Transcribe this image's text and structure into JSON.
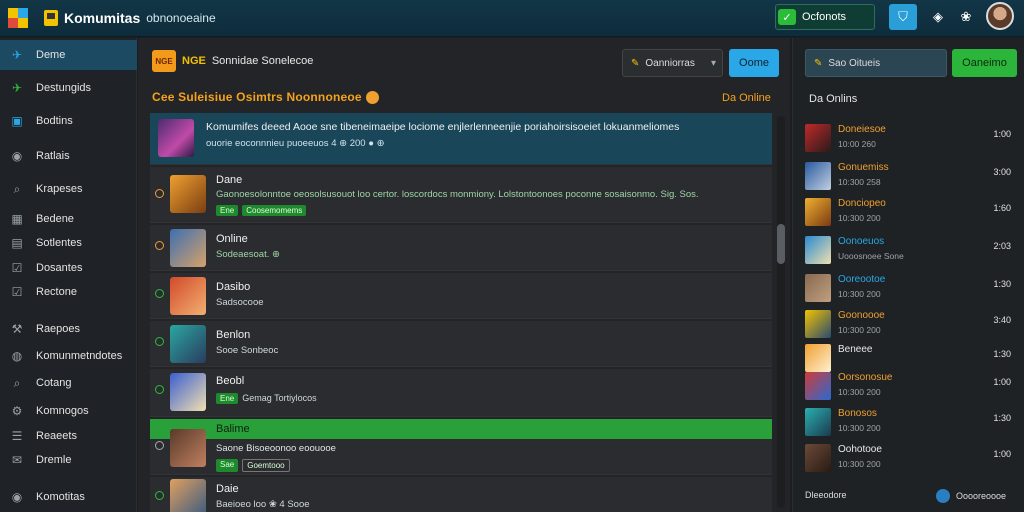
{
  "header": {
    "title": "Komumitas",
    "subtitle": "obnonoeaine",
    "status_label": "Ocfonots",
    "status_check": "✓",
    "icons": [
      "shield-icon",
      "gamepad-icon",
      "paw-icon"
    ]
  },
  "sidebar": {
    "items": [
      {
        "label": "Deme",
        "icon": "plane-icon",
        "glyph": "✈",
        "active": true
      },
      {
        "label": "Destungids",
        "icon": "plane-icon",
        "glyph": "✈"
      },
      {
        "label": "Bodtins",
        "icon": "square-icon",
        "glyph": "▣"
      },
      {
        "label": "Ratlais",
        "icon": "circle-icon",
        "glyph": "◉"
      },
      {
        "label": "Krapeses",
        "icon": "search-icon",
        "glyph": "⌕"
      },
      {
        "label": "Bedene",
        "icon": "grid-icon",
        "glyph": "▦"
      },
      {
        "label": "Sotlentes",
        "icon": "grid-icon",
        "glyph": "▤"
      },
      {
        "label": "Dosantes",
        "icon": "checkbox-icon",
        "glyph": "☑"
      },
      {
        "label": "Rectone",
        "icon": "checkbox-icon",
        "glyph": "☑"
      },
      {
        "label": "Raepoes",
        "icon": "wrench-icon",
        "glyph": "⚒"
      },
      {
        "label": "Komunmetndotes",
        "icon": "globe-icon",
        "glyph": "◍"
      },
      {
        "label": "Cotang",
        "icon": "search-icon",
        "glyph": "⌕"
      },
      {
        "label": "Komnogos",
        "icon": "tools-icon",
        "glyph": "⚙"
      },
      {
        "label": "Reaeets",
        "icon": "list-icon",
        "glyph": "☰"
      },
      {
        "label": "Dremle",
        "icon": "mail-icon",
        "glyph": "✉"
      },
      {
        "label": "Komotitas",
        "icon": "circle-icon",
        "glyph": "◉"
      }
    ]
  },
  "main": {
    "badge": "NGE",
    "header_title": "NGE",
    "header_text": "Sonnidae Sonelecoe",
    "select_label": "Oanniorras",
    "join_button": "Oome",
    "section_title": "Cee Suleisiue Osimtrs Noonnoneoe",
    "section_right": "Da Online",
    "rows": [
      {
        "name": "Komumifes deeed Aooe sne tibeneimaeipe lociome enjlerlenneenjie poriahoirsisoeiet lokuanmeliomes",
        "line2": "ouorie eoconnnieu puoeeuos 4 ⊕ 200 ● ⊕",
        "highlight": true
      },
      {
        "name": "Dane",
        "line2": "Gaonoesolonntoe oeosolsusouot loo certor. loscordocs monmiony. Lolstontoonoes poconne sosaisonmo. Sig. Sos.",
        "tags": [
          "Ene",
          "Coosemomems"
        ]
      },
      {
        "name": "Online",
        "line2": "Sodeaesoat. ⊕"
      },
      {
        "name": "Dasibo",
        "line2": "Sadsocooe"
      },
      {
        "name": "Benlon",
        "line2": "Sooe Sonbeoc"
      },
      {
        "name": "Beobl",
        "line2": "Gemag Tortiylocos",
        "tags": [
          "Ene"
        ]
      },
      {
        "name": "Balime",
        "line2": "Saone Bisoeoonoo eoouooe",
        "tags": [
          "Sae",
          "Goemtooo"
        ],
        "green": true
      },
      {
        "name": "Daie",
        "line2": "Baeioeo loo ❀ 4 Sooe"
      }
    ]
  },
  "right_panel": {
    "search_label": "Sao Oitueis",
    "green_button": "Oaneimo",
    "title": "Da Onlins",
    "friends": [
      {
        "name": "Doneiesoe",
        "sub": "10:00 260",
        "time": "1:00"
      },
      {
        "name": "Gonuemiss",
        "sub": "10:300 258",
        "time": "3:00"
      },
      {
        "name": "Donciopeo",
        "sub": "10:300 200",
        "time": "1:60"
      },
      {
        "name": "Oonoeuos",
        "sub": "Uooosnoee Sone",
        "time": "2:03"
      },
      {
        "name": "Ooreootoe",
        "sub": "10:300 200",
        "time": "1:30"
      },
      {
        "name": "Goonoooe",
        "sub": "10:300 200",
        "time": "3:40"
      },
      {
        "name": "Beneee",
        "sub": "",
        "time": "1:30"
      },
      {
        "name": "Oorsonosue",
        "sub": "10:300 200",
        "time": "1:00"
      },
      {
        "name": "Bonosos",
        "sub": "10:300 200",
        "time": "1:30"
      },
      {
        "name": "Oohotooe",
        "sub": "10:300 200",
        "time": "1:00"
      }
    ],
    "footer_left": "Dleeodore",
    "footer_right": "Ooooreoooe"
  }
}
